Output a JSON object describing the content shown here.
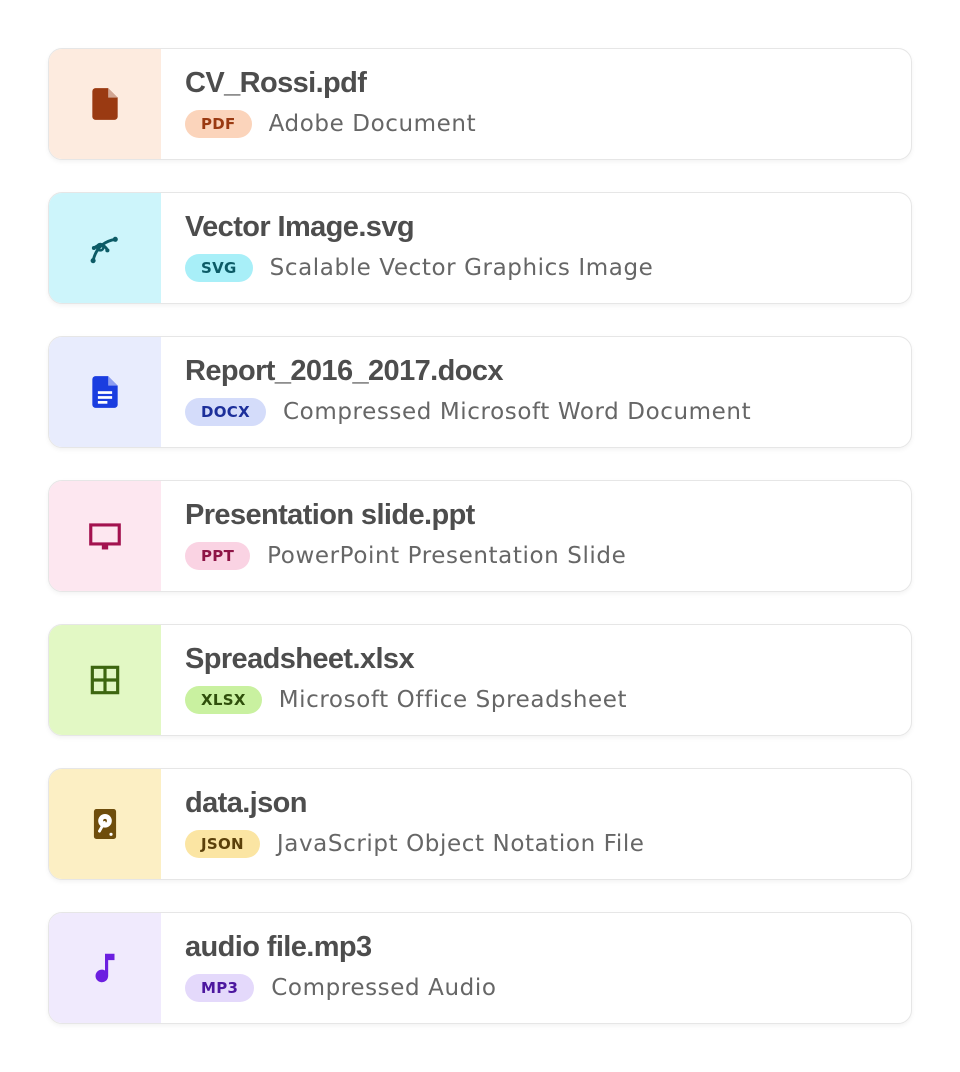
{
  "files": [
    {
      "name": "CV_Rossi.pdf",
      "badge": "PDF",
      "description": "Adobe Document",
      "icon": "pdf-file-icon",
      "icon_color": "#9a3a12",
      "tile_bg": "#fdebdf",
      "badge_bg": "#fbd4bb",
      "badge_fg": "#9a3a12"
    },
    {
      "name": "Vector Image.svg",
      "badge": "SVG",
      "description": "Scalable Vector Graphics Image",
      "icon": "vector-curve-icon",
      "icon_color": "#0c5b66",
      "tile_bg": "#cdf5fb",
      "badge_bg": "#a8eff8",
      "badge_fg": "#0c5b66"
    },
    {
      "name": "Report_2016_2017.docx",
      "badge": "DOCX",
      "description": "Compressed Microsoft Word Document",
      "icon": "document-icon",
      "icon_color": "#1a3de0",
      "tile_bg": "#e8ecfd",
      "badge_bg": "#d4dcfa",
      "badge_fg": "#1c2f9a"
    },
    {
      "name": "Presentation slide.ppt",
      "badge": "PPT",
      "description": "PowerPoint Presentation Slide",
      "icon": "monitor-icon",
      "icon_color": "#a3124f",
      "tile_bg": "#fde7f0",
      "badge_bg": "#fad3e3",
      "badge_fg": "#8e1446"
    },
    {
      "name": "Spreadsheet.xlsx",
      "badge": "XLSX",
      "description": "Microsoft Office Spreadsheet",
      "icon": "grid-icon",
      "icon_color": "#3d6610",
      "tile_bg": "#e2f8c4",
      "badge_bg": "#c9f1a0",
      "badge_fg": "#2f4f0b"
    },
    {
      "name": "data.json",
      "badge": "JSON",
      "description": "JavaScript Object Notation File",
      "icon": "harddisk-icon",
      "icon_color": "#6e4d0c",
      "tile_bg": "#fcefc4",
      "badge_bg": "#fbe5a3",
      "badge_fg": "#5b400a"
    },
    {
      "name": "audio file.mp3",
      "badge": "MP3",
      "description": "Compressed Audio",
      "icon": "music-note-icon",
      "icon_color": "#6c1fe0",
      "tile_bg": "#f0eafd",
      "badge_bg": "#e4d9fb",
      "badge_fg": "#4c179f"
    }
  ]
}
